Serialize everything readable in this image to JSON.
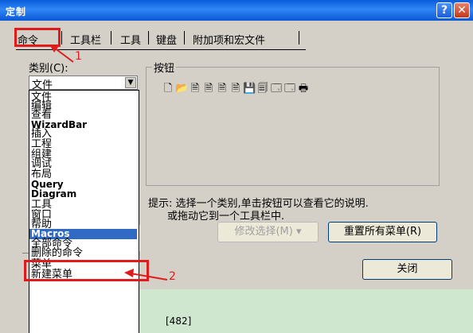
{
  "window": {
    "title": "定制",
    "help_label": "?",
    "close_label": "✕"
  },
  "tabs": [
    {
      "label": "命令"
    },
    {
      "label": "工具栏"
    },
    {
      "label": "工具"
    },
    {
      "label": "键盘"
    },
    {
      "label": "附加项和宏文件"
    }
  ],
  "category": {
    "label": "类别(C):",
    "selected": "文件"
  },
  "dropdown": {
    "items": [
      "文件",
      "编辑",
      "查看",
      "WizardBar",
      "插入",
      "工程",
      "组建",
      "调试",
      "布局",
      "Query",
      "Diagram",
      "工具",
      "窗口",
      "帮助",
      "Macros",
      "全部命令",
      "删除的命令",
      "菜单",
      "新建菜单"
    ],
    "selected": "Macros"
  },
  "buttons_group": {
    "legend": "按钮",
    "icons": [
      "new-file-icon",
      "open-folder-icon",
      "file-icon",
      "file-icon",
      "file-icon",
      "file-icon",
      "save-icon",
      "save-all-icon",
      "window-icon",
      "window-icon",
      "print-icon"
    ],
    "glyphs": [
      "🗋",
      "📂",
      "🗎",
      "🗎",
      "🗎",
      "🗎",
      "💾",
      "🗐",
      "🗔",
      "🗔",
      "🖶"
    ]
  },
  "hint": {
    "line1": "提示: 选择一个类别,单击按钮可以查看它的说明.",
    "line2": "或拖动它到一个工具栏中."
  },
  "buttons": {
    "modify": "修改选择(M) ▾",
    "reset": "重置所有菜单(R)",
    "close": "关闭"
  },
  "annotations": {
    "one": "1",
    "two": "2",
    "color": "#e01b1b"
  },
  "bottom_text": "[482]"
}
